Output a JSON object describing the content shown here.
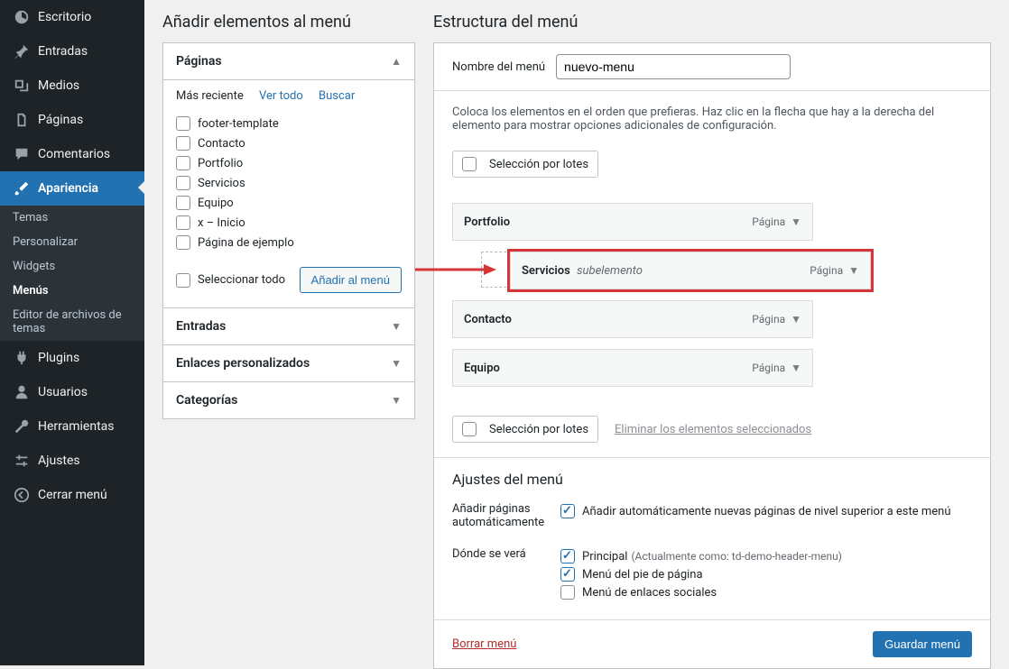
{
  "sidebar": {
    "items": [
      {
        "id": "dashboard",
        "label": "Escritorio"
      },
      {
        "id": "posts",
        "label": "Entradas"
      },
      {
        "id": "media",
        "label": "Medios"
      },
      {
        "id": "pages",
        "label": "Páginas"
      },
      {
        "id": "comments",
        "label": "Comentarios"
      },
      {
        "id": "appearance",
        "label": "Apariencia",
        "active": true
      },
      {
        "id": "plugins",
        "label": "Plugins"
      },
      {
        "id": "users",
        "label": "Usuarios"
      },
      {
        "id": "tools",
        "label": "Herramientas"
      },
      {
        "id": "settings",
        "label": "Ajustes"
      },
      {
        "id": "collapse",
        "label": "Cerrar menú"
      }
    ],
    "subitems": [
      {
        "id": "themes",
        "label": "Temas"
      },
      {
        "id": "customize",
        "label": "Personalizar"
      },
      {
        "id": "widgets",
        "label": "Widgets"
      },
      {
        "id": "menus",
        "label": "Menús",
        "active": true
      },
      {
        "id": "theme-editor",
        "label": "Editor de archivos de temas"
      }
    ]
  },
  "left": {
    "title": "Añadir elementos al menú",
    "box_pages_title": "Páginas",
    "tabs": {
      "recent": "Más reciente",
      "all": "Ver todo",
      "search": "Buscar"
    },
    "pages": [
      "footer-template",
      "Contacto",
      "Portfolio",
      "Servicios",
      "Equipo",
      "x – Inicio",
      "Página de ejemplo"
    ],
    "select_all": "Seleccionar todo",
    "btn_add": "Añadir al menú",
    "box_posts_title": "Entradas",
    "box_links_title": "Enlaces personalizados",
    "box_cats_title": "Categorías"
  },
  "right": {
    "title": "Estructura del menú",
    "menu_name_label": "Nombre del menú",
    "menu_name_value": "nuevo-menu",
    "help_text": "Coloca los elementos en el orden que prefieras. Haz clic en la flecha que hay a la derecha del elemento para mostrar opciones adicionales de configuración.",
    "bulk_label": "Selección por lotes",
    "remove_selected": "Eliminar los elementos seleccionados",
    "items": [
      {
        "title": "Portfolio",
        "type": "Página"
      },
      {
        "title": "Servicios",
        "sub": "subelemento",
        "type": "Página",
        "indent": true,
        "highlight": true
      },
      {
        "title": "Contacto",
        "type": "Página"
      },
      {
        "title": "Equipo",
        "type": "Página"
      }
    ],
    "settings_heading": "Ajustes del menú",
    "auto_add_label": "Añadir páginas\nautomáticamente",
    "auto_add_option": "Añadir automáticamente nuevas páginas de nivel superior a este menú",
    "locations_label": "Dónde se verá",
    "locations": [
      {
        "label": "Principal",
        "paren": "(Actualmente como: td-demo-header-menu)",
        "checked": true
      },
      {
        "label": "Menú del pie de página",
        "checked": true
      },
      {
        "label": "Menú de enlaces sociales",
        "checked": false
      }
    ],
    "delete_link": "Borrar menú",
    "save_btn": "Guardar menú"
  }
}
